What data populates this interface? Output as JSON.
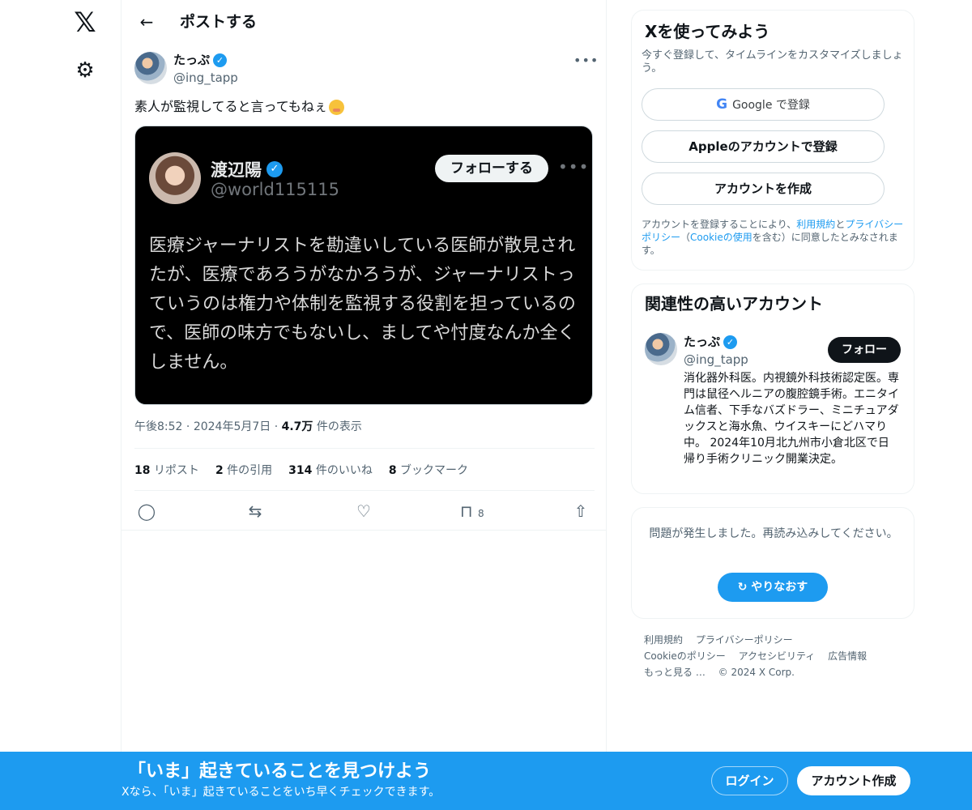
{
  "nav": {
    "logo_icon": "x-logo-icon",
    "logo_glyph": "𝕏",
    "settings_icon": "gear-icon",
    "settings_glyph": "⚙"
  },
  "header": {
    "back_glyph": "←",
    "title": "ポストする"
  },
  "post": {
    "author_name": "たっぷ",
    "author_handle": "@ing_tapp",
    "verified_glyph": "✓",
    "more_glyph": "•••",
    "text": "素人が監視してると言ってもねぇ",
    "embedded": {
      "name": "渡辺陽",
      "handle": "@world115115",
      "follow_label": "フォローする",
      "more_glyph": "•••",
      "text": "医療ジャーナリストを勘違いしている医師が散見されたが、医療であろうがなかろうが、ジャーナリストっていうのは権力や体制を監視する役割を担っているので、医師の味方でもないし、ましてや忖度なんか全くしません。"
    },
    "time": "午後8:52",
    "date": "2024年5月7日",
    "views_count": "4.7万",
    "views_label": "件の表示",
    "stats": [
      {
        "count": "18",
        "label": "リポスト"
      },
      {
        "count": "2",
        "label": "件の引用"
      },
      {
        "count": "314",
        "label": "件のいいね"
      },
      {
        "count": "8",
        "label": "ブックマーク"
      }
    ],
    "actions": {
      "reply_glyph": "◯",
      "repost_glyph": "⇆",
      "like_glyph": "♡",
      "bookmark_glyph": "⊓",
      "bookmark_count": "8",
      "share_glyph": "⇧"
    }
  },
  "signup_card": {
    "title": "Xを使ってみよう",
    "subtitle": "今すぐ登録して、タイムラインをカスタマイズしましょう。",
    "google_g": "G",
    "google_label": "Google で登録",
    "apple_glyph": "",
    "apple_label": "Appleのアカウントで登録",
    "create_label": "アカウントを作成",
    "legal_1": "アカウントを登録することにより、",
    "legal_terms": "利用規約",
    "legal_and": "と",
    "legal_privacy": "プライバシーポリシー",
    "legal_2": "（",
    "legal_cookie": "Cookieの使用",
    "legal_3": "を含む）に同意したとみなされます。"
  },
  "related_card": {
    "title": "関連性の高いアカウント",
    "name": "たっぷ",
    "handle": "@ing_tapp",
    "follow_label": "フォロー",
    "bio": "消化器外科医。内視鏡外科技術認定医。専門は鼠径ヘルニアの腹腔鏡手術。エニタイム信者、下手なバズドラー、ミニチュアダックスと海水魚、ウイスキーにどハマり中。 2024年10月北九州市小倉北区で日帰り手術クリニック開業決定。"
  },
  "error_card": {
    "message": "問題が発生しました。再読み込みしてください。",
    "retry_glyph": "↻",
    "retry_label": "やりなおす"
  },
  "footer": {
    "links": [
      "利用規約",
      "プライバシーポリシー",
      "Cookieのポリシー",
      "アクセシビリティ",
      "広告情報",
      "もっと見る …",
      "© 2024 X Corp."
    ]
  },
  "bottom_bar": {
    "title": "「いま」起きていることを見つけよう",
    "subtitle": "Xなら、「いま」起きていることをいち早くチェックできます。",
    "login_label": "ログイン",
    "signup_label": "アカウント作成"
  },
  "colors": {
    "accent": "#1d9bf0",
    "text": "#0f1419",
    "muted": "#536471"
  }
}
